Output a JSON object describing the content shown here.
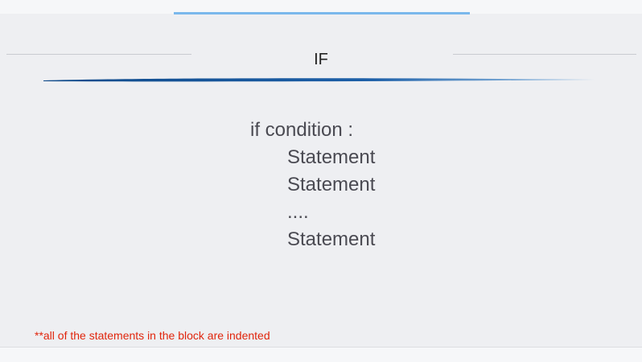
{
  "slide": {
    "title": "IF",
    "code_lines": [
      "if condition :",
      "Statement",
      "Statement",
      "....",
      "Statement"
    ],
    "footnote": "**all of the statements in the block are indented"
  },
  "colors": {
    "background": "#eeeff2",
    "top_accent": "#7ab8ec",
    "title_swoosh": "#1c5fa8",
    "code_text": "#4a4a52",
    "footnote_text": "#e0250c"
  }
}
